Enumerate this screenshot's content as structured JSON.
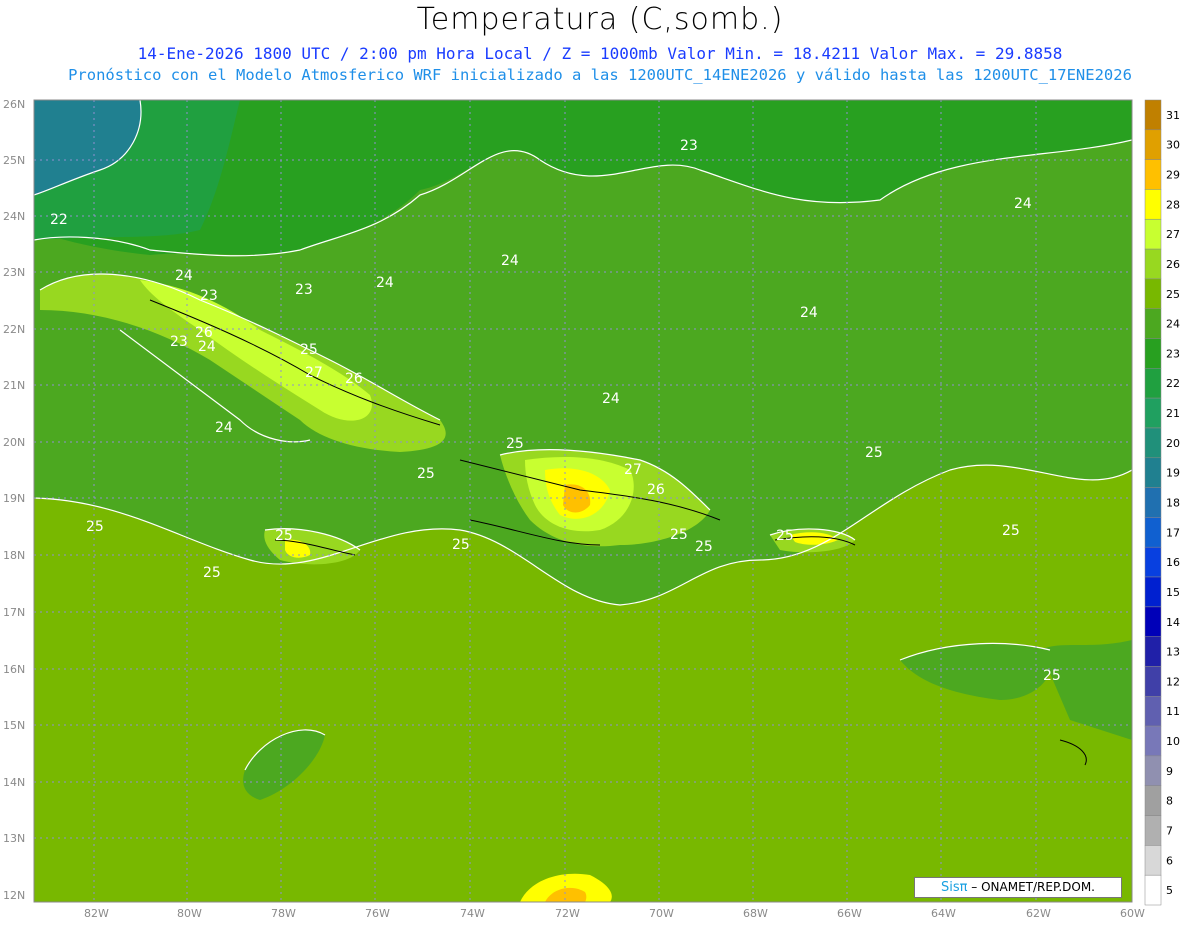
{
  "header": {
    "title": "Temperatura (C,somb.)",
    "line1": "14-Ene-2026  1800 UTC / 2:00 pm Hora Local / Z = 1000mb   Valor Min. = 18.4211  Valor Max. = 29.8858",
    "line2": "Pronóstico con el Modelo Atmosferico WRF inicializado a las 1200UTC_14ENE2026 y válido hasta las  1200UTC_17ENE2026"
  },
  "map": {
    "lat_labels": [
      "26N",
      "25N",
      "24N",
      "23N",
      "22N",
      "21N",
      "20N",
      "19N",
      "18N",
      "17N",
      "16N",
      "15N",
      "14N",
      "13N",
      "12N"
    ],
    "lon_labels": [
      "82W",
      "80W",
      "78W",
      "76W",
      "74W",
      "72W",
      "70W",
      "68W",
      "66W",
      "64W",
      "62W",
      "60W"
    ],
    "contour_labels": [
      "22",
      "23",
      "24",
      "23",
      "24",
      "24",
      "23",
      "24",
      "26",
      "23",
      "24",
      "25",
      "27",
      "26",
      "24",
      "24",
      "24",
      "25",
      "25",
      "25",
      "27",
      "26",
      "25",
      "25",
      "25",
      "25",
      "25",
      "25",
      "25",
      "25",
      "25"
    ]
  },
  "colorbar": {
    "labels": [
      "31",
      "30",
      "29",
      "28",
      "27",
      "26",
      "25",
      "24",
      "23",
      "22",
      "21",
      "20",
      "19",
      "18",
      "17",
      "16",
      "15",
      "14",
      "13",
      "12",
      "11",
      "10",
      "9",
      "8",
      "7",
      "6",
      "5"
    ],
    "colors": [
      "#c08000",
      "#e0a000",
      "#ffc000",
      "#ffff00",
      "#c8ff30",
      "#98d820",
      "#78b800",
      "#4ca820",
      "#28a020",
      "#20a040",
      "#20a060",
      "#20907a",
      "#208090",
      "#2070b0",
      "#1060d0",
      "#0840e0",
      "#0020d0",
      "#0000b8",
      "#2020a8",
      "#4040a8",
      "#6060b0",
      "#7878b8",
      "#9090b0",
      "#a0a0a0",
      "#b0b0b0",
      "#d8d8d8",
      "#ffffff"
    ]
  },
  "credit": {
    "brand": "Sisπ",
    "text": " – ONAMET/REP.DOM."
  }
}
